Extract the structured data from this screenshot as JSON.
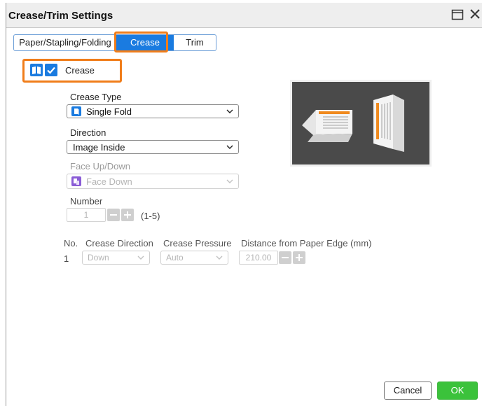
{
  "window": {
    "title": "Crease/Trim Settings"
  },
  "tabs": [
    {
      "label": "Paper/Stapling/Folding"
    },
    {
      "label": "Crease"
    },
    {
      "label": "Trim"
    }
  ],
  "crease": {
    "label": "Crease",
    "checked": true
  },
  "crease_type": {
    "label": "Crease Type",
    "value": "Single Fold"
  },
  "direction": {
    "label": "Direction",
    "value": "Image Inside"
  },
  "face": {
    "label": "Face Up/Down",
    "value": "Face Down"
  },
  "number": {
    "label": "Number",
    "value": "1",
    "range": "(1-5)"
  },
  "table": {
    "headers": {
      "no": "No.",
      "direction": "Crease Direction",
      "pressure": "Crease Pressure",
      "distance": "Distance from Paper Edge (mm)"
    },
    "rows": [
      {
        "no": "1",
        "direction": "Down",
        "pressure": "Auto",
        "distance": "210.00"
      }
    ]
  },
  "buttons": {
    "cancel": "Cancel",
    "ok": "OK"
  },
  "colors": {
    "accent": "#1a7be0",
    "highlight": "#f07d1a",
    "ok": "#3bc23b"
  }
}
